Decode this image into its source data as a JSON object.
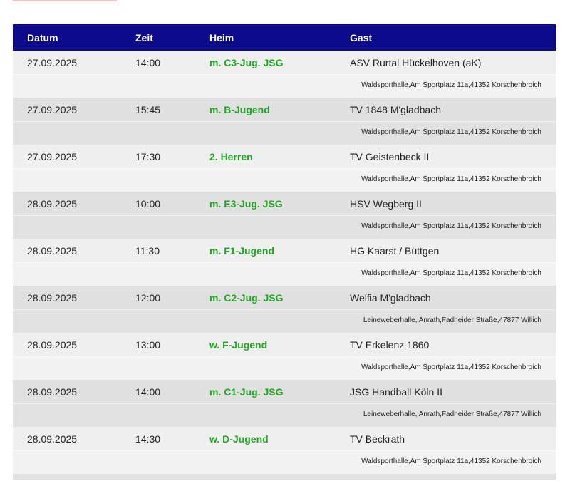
{
  "table": {
    "headers": {
      "date": "Datum",
      "time": "Zeit",
      "home": "Heim",
      "guest": "Gast"
    },
    "matches": [
      {
        "date": "27.09.2025",
        "time": "14:00",
        "home": "m. C3-Jug. JSG",
        "guest": "ASV Rurtal Hückelhoven (aK)",
        "venue": "Waldsporthalle,Am Sportplatz 11a,41352 Korschenbroich"
      },
      {
        "date": "27.09.2025",
        "time": "15:45",
        "home": "m. B-Jugend",
        "guest": "TV 1848 M'gladbach",
        "venue": "Waldsporthalle,Am Sportplatz 11a,41352 Korschenbroich"
      },
      {
        "date": "27.09.2025",
        "time": "17:30",
        "home": "2. Herren",
        "guest": "TV Geistenbeck II",
        "venue": "Waldsporthalle,Am Sportplatz 11a,41352 Korschenbroich"
      },
      {
        "date": "28.09.2025",
        "time": "10:00",
        "home": "m. E3-Jug. JSG",
        "guest": "HSV Wegberg II",
        "venue": "Waldsporthalle,Am Sportplatz 11a,41352 Korschenbroich"
      },
      {
        "date": "28.09.2025",
        "time": "11:30",
        "home": "m. F1-Jugend",
        "guest": "HG Kaarst / Büttgen",
        "venue": "Waldsporthalle,Am Sportplatz 11a,41352 Korschenbroich"
      },
      {
        "date": "28.09.2025",
        "time": "12:00",
        "home": "m. C2-Jug. JSG",
        "guest": "Welfia M'gladbach",
        "venue": "Leineweberhalle, Anrath,Fadheider Straße,47877 Willich"
      },
      {
        "date": "28.09.2025",
        "time": "13:00",
        "home": "w. F-Jugend",
        "guest": "TV Erkelenz 1860",
        "venue": "Waldsporthalle,Am Sportplatz 11a,41352 Korschenbroich"
      },
      {
        "date": "28.09.2025",
        "time": "14:00",
        "home": "m. C1-Jug. JSG",
        "guest": "JSG Handball Köln II",
        "venue": "Leineweberhalle, Anrath,Fadheider Straße,47877 Willich"
      },
      {
        "date": "28.09.2025",
        "time": "14:30",
        "home": "w. D-Jugend",
        "guest": "TV Beckrath",
        "venue": "Waldsporthalle,Am Sportplatz 11a,41352 Korschenbroich"
      }
    ]
  },
  "colors": {
    "header_bg": "#0b0b8c",
    "header_text": "#ffffff",
    "home_team": "#21a821",
    "row_light": "#efefef",
    "row_dark": "#e0e0e0"
  }
}
